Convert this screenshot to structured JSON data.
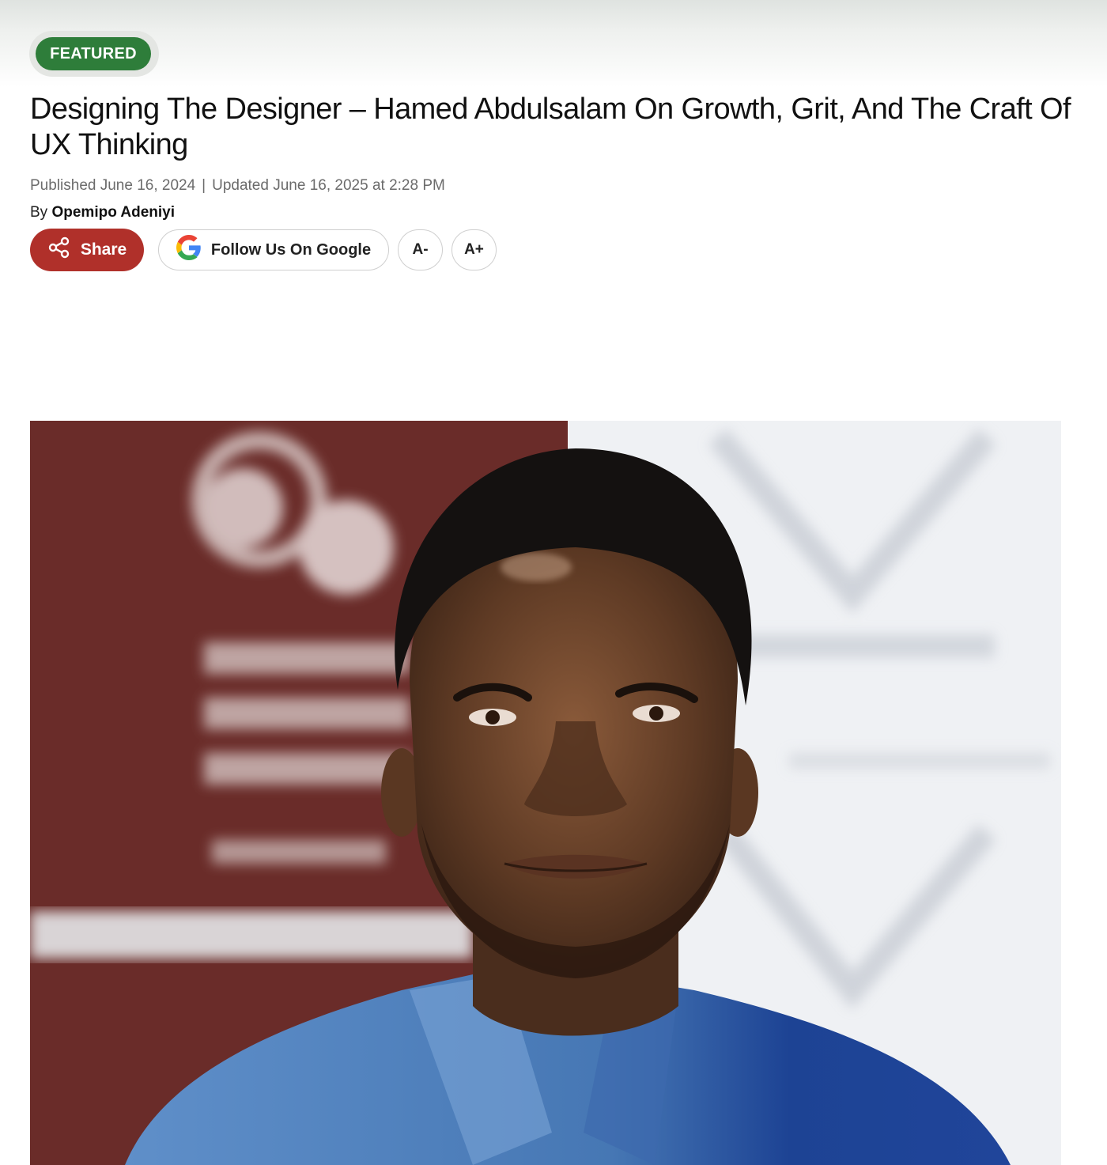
{
  "badge": {
    "label": "FEATURED",
    "color": "#2e7d3a"
  },
  "article": {
    "title": "Designing The Designer – Hamed Abdulsalam On Growth, Grit, And The Craft Of UX Thinking",
    "published": "Published June 16, 2024",
    "separator": "|",
    "updated": "Updated June 16, 2025 at 2:28 PM",
    "by_prefix": "By",
    "author": "Opemipo Adeniyi"
  },
  "actions": {
    "share_label": "Share",
    "share_color": "#b0302a",
    "share_icon": "share-icon",
    "google_label": "Follow Us On Google",
    "google_icon": "google-g-icon",
    "font_decrease_label": "A-",
    "font_increase_label": "A+"
  },
  "hero_image": {
    "subject": "portrait-photo",
    "background_colors": [
      "#6e2f2b",
      "#eef0f3"
    ]
  }
}
